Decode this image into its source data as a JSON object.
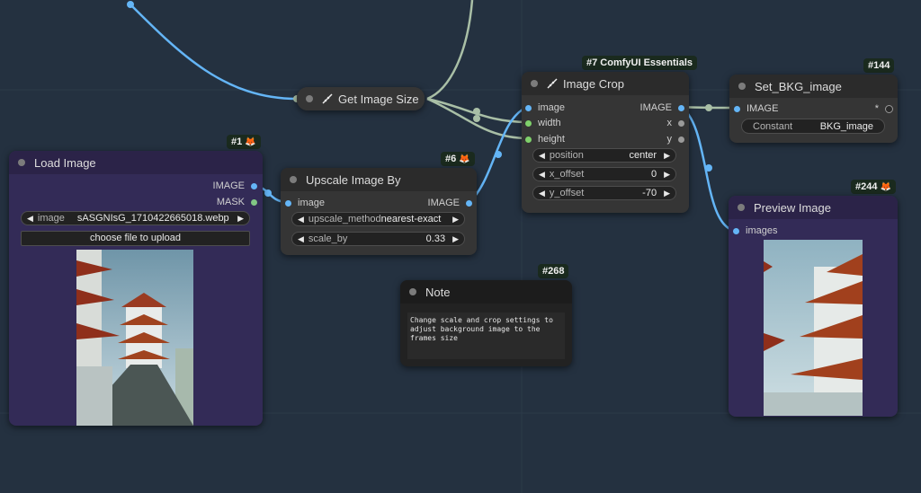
{
  "nodes": {
    "load_image": {
      "title": "Load Image",
      "badge_id": "#1",
      "outputs": [
        "IMAGE",
        "MASK"
      ],
      "widget_name": "image",
      "widget_value": "sASGNIsG_1710422665018.webp",
      "upload_label": "choose file to upload"
    },
    "get_image_size": {
      "title": "Get Image Size"
    },
    "upscale": {
      "title": "Upscale Image By",
      "badge_id": "#6",
      "input": "image",
      "output": "IMAGE",
      "upscale_method_name": "upscale_method",
      "upscale_method_value": "nearest-exact",
      "scale_by_name": "scale_by",
      "scale_by_value": "0.33"
    },
    "image_crop": {
      "title": "Image Crop",
      "badge": "#7 ComfyUI Essentials",
      "inputs": [
        "image",
        "width",
        "height"
      ],
      "outputs": [
        "IMAGE",
        "x",
        "y"
      ],
      "position_name": "position",
      "position_value": "center",
      "x_offset_name": "x_offset",
      "x_offset_value": "0",
      "y_offset_name": "y_offset",
      "y_offset_value": "-70"
    },
    "set_bkg": {
      "title": "Set_BKG_image",
      "badge_id": "#144",
      "input": "IMAGE",
      "output_marker": "*",
      "constant_name": "Constant",
      "constant_value": "BKG_image"
    },
    "preview": {
      "title": "Preview Image",
      "badge_id": "#244",
      "input": "images"
    },
    "note": {
      "title": "Note",
      "badge_id": "#268",
      "text": "Change scale and crop settings to adjust background image to the frames size"
    }
  },
  "colors": {
    "canvas": "#243140",
    "node_dark": "#353535",
    "node_purple": "#332b57",
    "wire_image": "#64b5f6",
    "wire_int": "#a9bfa6",
    "badge_bg": "#1a2a1e"
  },
  "icons": [
    "ruler-icon",
    "fox-icon",
    "arrow-left-icon",
    "arrow-right-icon"
  ]
}
